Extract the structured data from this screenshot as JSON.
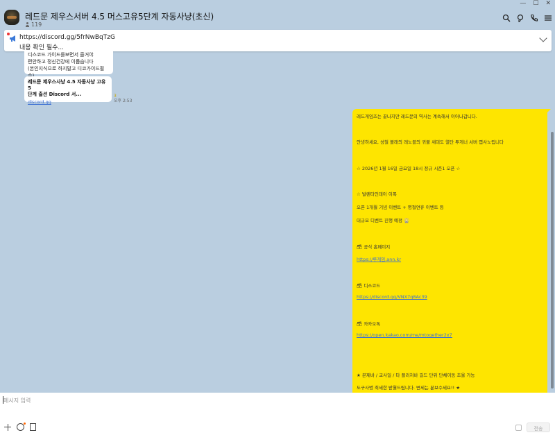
{
  "header": {
    "title": "레드문 제우스서버 4.5 머스고유5단계 자동사냥(초신)",
    "member_count": "119",
    "window_controls": [
      "—",
      "☐",
      "✕"
    ],
    "tool_icons": [
      "search-icon",
      "ai-icon",
      "call-icon",
      "menu-icon"
    ]
  },
  "notice": {
    "line1": "https://discord.gg/5frNwBqTzG",
    "line2": "내용 확인 필수..."
  },
  "messages": {
    "partial_lines": [
      "디스코드 가이드를보면서 즐거야",
      "편안하고 정신건강에 이롭습니다",
      "(본인지식으로 하지말고 디코가이드필수)"
    ],
    "link_card": {
      "title_line1": "레드문 제우스사냥 4.5 자동사냥 고유5",
      "title_line2": "단계 출션 Discord 서...",
      "url": "discord.gg"
    },
    "left_meta": {
      "read_count": "3",
      "time": "오후 2:53"
    },
    "own_message": {
      "lines": [
        "레드게임즈는 끝나지만 레드문의 역사는 계속해서 이어나갑니다.",
        "안녕하세요, 성철 볼래의 레노블의 귀불 새대도 열단 투게너 서버 엽사노립니다",
        "☆ 2026년 1월 16일 금요일 18시 정규 시즌1 오픈 ☆",
        "☆ 발렌타인데이 이폭",
        "오픈 1개월 기념 이벤트 + 명절연휴 이벤트 등",
        "대규모 디벤트 진행 예정 🎡",
        "🗃 공식 홈페이지",
        "https://루게임.ann.kr",
        "🗃 디스코드",
        "https://discord.gg/VNX7q8Ac39",
        "🗃 카카오톡",
        "https://open.kakao.com/me/mtogether2x7",
        "★ 본제바 / 교사일 / 타 플러처바 길드 단위 단체이동 초울 가능",
        "도구사병 최세한 받월드립니다. 변세는 분보수세요!! ★"
      ]
    }
  },
  "input": {
    "placeholder": "메시지 입력",
    "send_label": "전송"
  },
  "colors": {
    "chat_bg": "#bacee0",
    "own_bubble": "#fee500",
    "link": "#3b6fd4"
  }
}
